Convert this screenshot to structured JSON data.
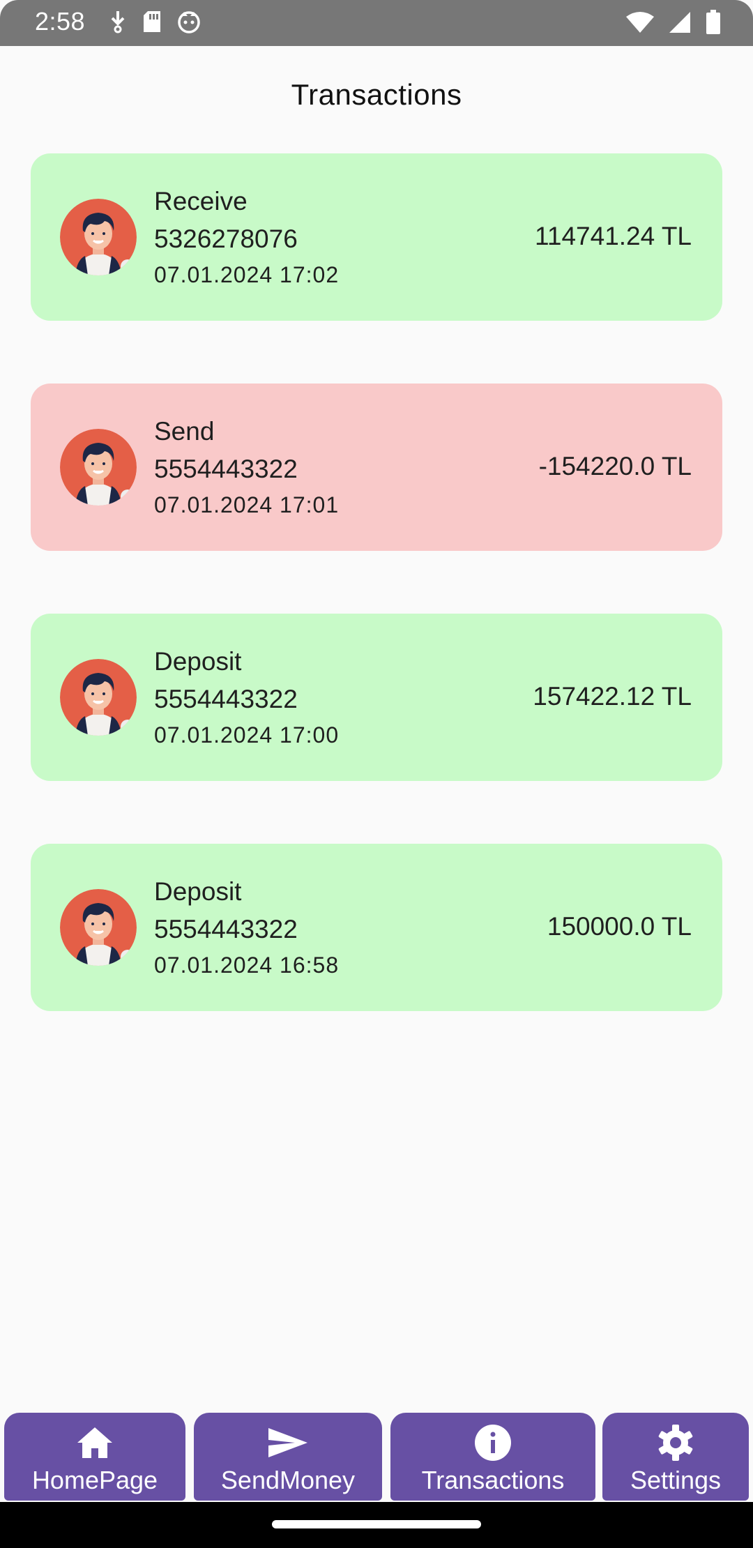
{
  "status_bar": {
    "time": "2:58"
  },
  "page": {
    "title": "Transactions"
  },
  "colors": {
    "income_card": "#C8FAC8",
    "outgoing_card": "#F9C9C9",
    "nav_button": "#6750A4",
    "avatar_bg": "#E45F47"
  },
  "transactions": [
    {
      "type": "Receive",
      "phone": "5326278076",
      "date": "07.01.2024 17:02",
      "amount": "114741.24 TL",
      "direction": "in"
    },
    {
      "type": "Send",
      "phone": "5554443322",
      "date": "07.01.2024 17:01",
      "amount": "-154220.0 TL",
      "direction": "out"
    },
    {
      "type": "Deposit",
      "phone": "5554443322",
      "date": "07.01.2024 17:00",
      "amount": "157422.12 TL",
      "direction": "in"
    },
    {
      "type": "Deposit",
      "phone": "5554443322",
      "date": "07.01.2024 16:58",
      "amount": "150000.0 TL",
      "direction": "in"
    }
  ],
  "bottom_nav": [
    {
      "label": "HomePage",
      "icon": "home-icon"
    },
    {
      "label": "SendMoney",
      "icon": "send-icon"
    },
    {
      "label": "Transactions",
      "icon": "info-icon"
    },
    {
      "label": "Settings",
      "icon": "gear-icon"
    }
  ]
}
